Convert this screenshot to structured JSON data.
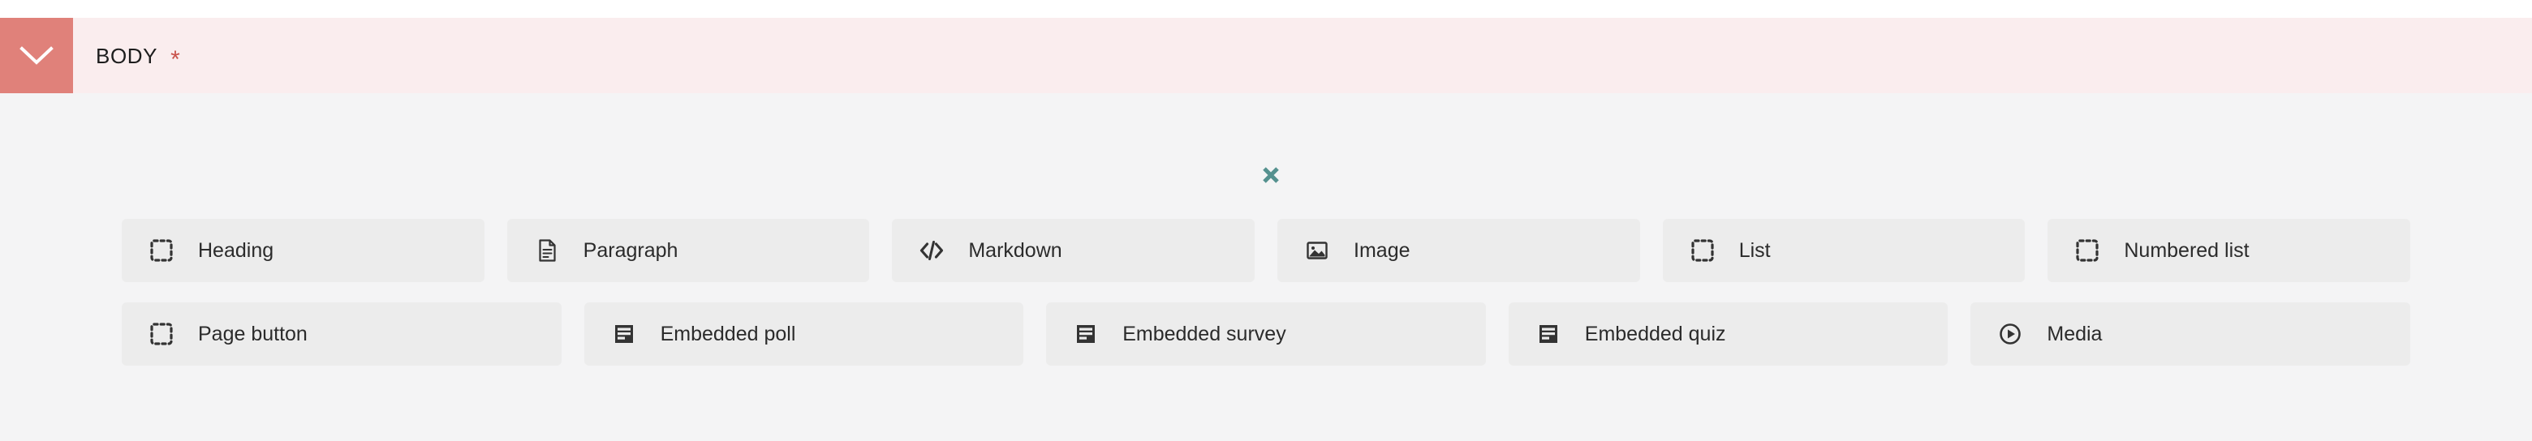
{
  "section": {
    "title": "BODY",
    "required_marker": "*",
    "collapse_icon": "chevron-down-icon",
    "header_bg": "#FAEDEE",
    "toggle_bg": "#E0817A",
    "required_color": "#C9524B"
  },
  "picker": {
    "close_icon": "close-icon",
    "close_color": "#55918F",
    "background": "#F4F4F5",
    "button_bg": "#ECECEC",
    "rows": [
      {
        "blocks": [
          {
            "label": "Heading",
            "icon": "placeholder-dashed-square-icon"
          },
          {
            "label": "Paragraph",
            "icon": "document-text-icon"
          },
          {
            "label": "Markdown",
            "icon": "code-brackets-icon"
          },
          {
            "label": "Image",
            "icon": "image-icon"
          },
          {
            "label": "List",
            "icon": "placeholder-dashed-square-icon"
          },
          {
            "label": "Numbered list",
            "icon": "placeholder-dashed-square-icon"
          }
        ]
      },
      {
        "blocks": [
          {
            "label": "Page button",
            "icon": "placeholder-dashed-square-icon"
          },
          {
            "label": "Embedded poll",
            "icon": "form-rows-icon"
          },
          {
            "label": "Embedded survey",
            "icon": "form-rows-icon"
          },
          {
            "label": "Embedded quiz",
            "icon": "form-rows-icon"
          },
          {
            "label": "Media",
            "icon": "play-circle-icon"
          }
        ]
      }
    ]
  }
}
